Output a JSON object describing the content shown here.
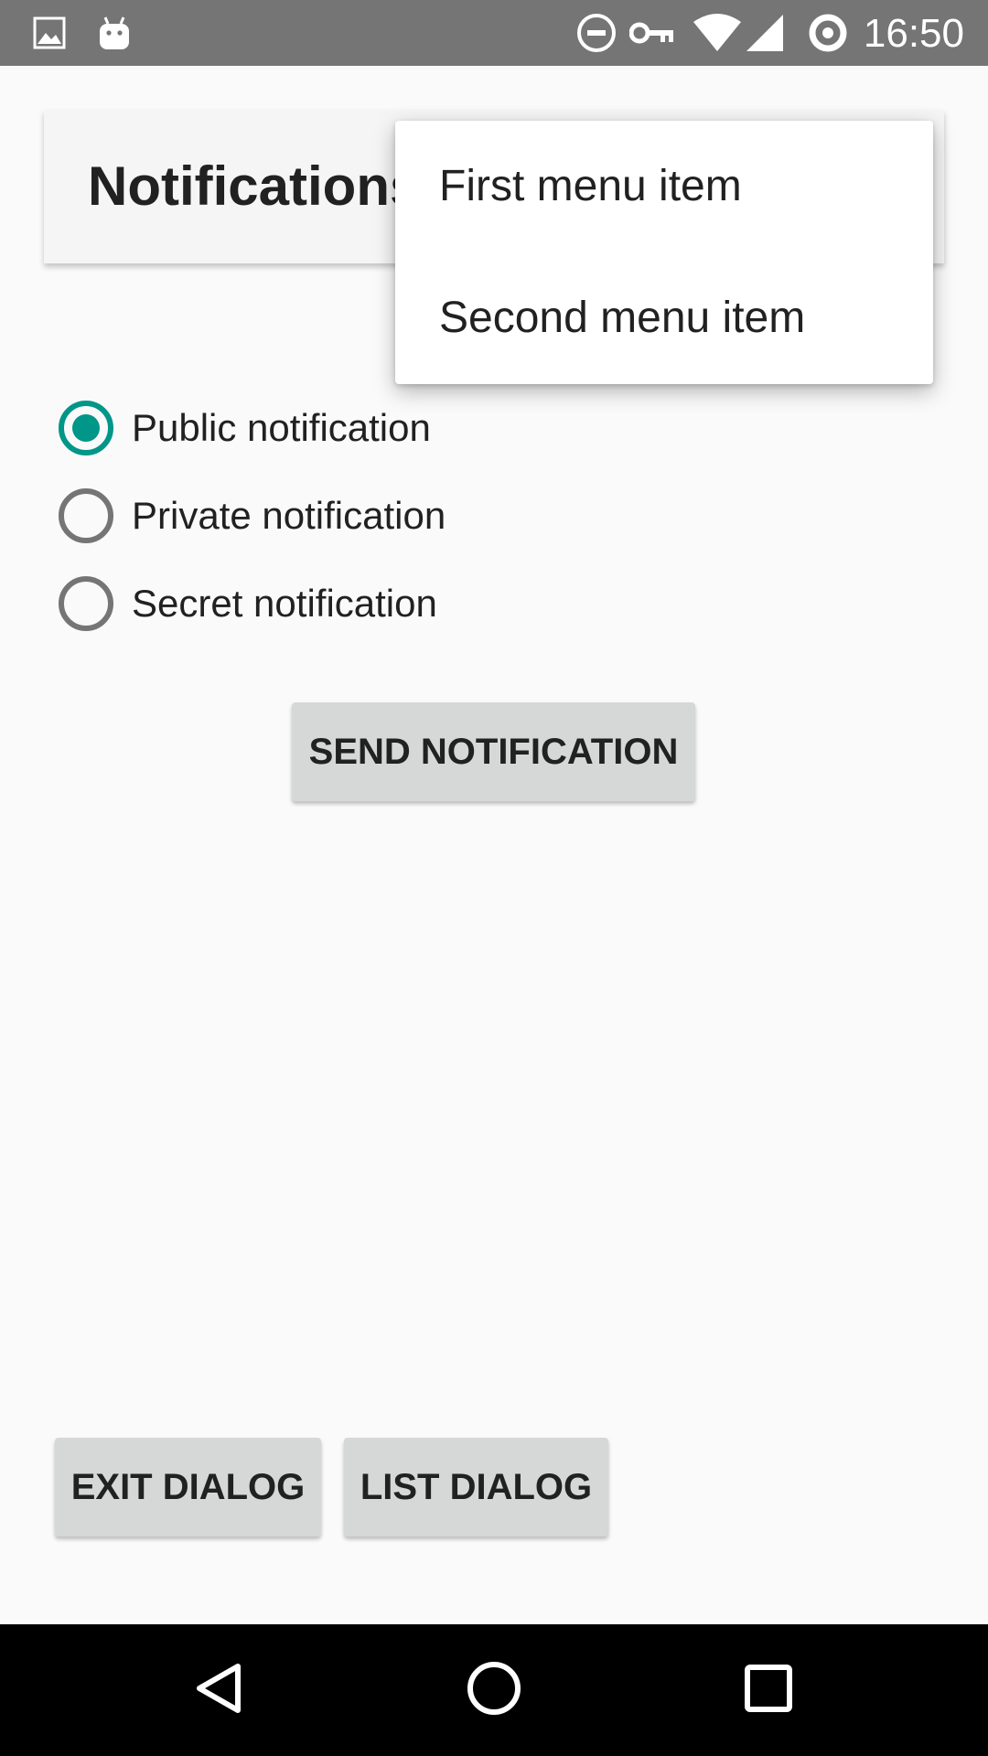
{
  "status_bar": {
    "time": "16:50",
    "left_icons": [
      "image-icon",
      "android-icon"
    ],
    "right_icons": [
      "do-not-disturb-icon",
      "vpn-key-icon",
      "wifi-icon",
      "cell-signal-icon",
      "sync-icon"
    ],
    "background": "#757575"
  },
  "toolbar": {
    "title": "Notifications"
  },
  "popup_menu": {
    "items": [
      {
        "label": "First menu item"
      },
      {
        "label": "Second menu item"
      }
    ]
  },
  "radio_group": {
    "options": [
      {
        "label": "Public notification",
        "checked": true
      },
      {
        "label": "Private notification",
        "checked": false
      },
      {
        "label": "Secret notification",
        "checked": false
      }
    ],
    "accent_color": "#009688"
  },
  "buttons": {
    "send": "SEND NOTIFICATION",
    "exit_dialog": "EXIT DIALOG",
    "list_dialog": "LIST DIALOG"
  },
  "nav_bar": {
    "icons": [
      "back-icon",
      "home-icon",
      "recents-icon"
    ]
  }
}
